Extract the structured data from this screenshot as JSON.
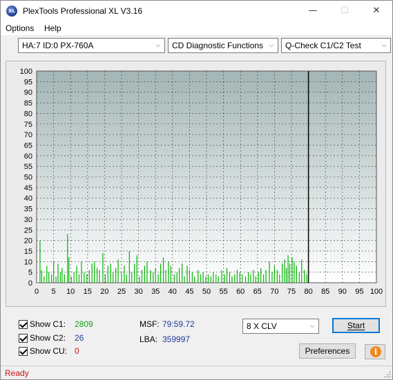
{
  "window": {
    "title": "PlexTools Professional XL V3.16",
    "app_icon_text": "XL",
    "minimize_glyph": "—",
    "maximize_glyph": "☐",
    "close_glyph": "✕"
  },
  "menu": {
    "items": [
      "Options",
      "Help"
    ]
  },
  "toolbar": {
    "drive": "HA:7 ID:0  PX-760A",
    "function": "CD Diagnostic Functions",
    "test": "Q-Check C1/C2 Test",
    "arrow_glyph": "⌵"
  },
  "chart_data": {
    "type": "bar",
    "title": "",
    "xlabel": "",
    "ylabel": "",
    "xlim": [
      0,
      100
    ],
    "ylim": [
      0,
      100
    ],
    "x_ticks": [
      0,
      5,
      10,
      15,
      20,
      25,
      30,
      35,
      40,
      45,
      50,
      55,
      60,
      65,
      70,
      75,
      80,
      85,
      90,
      95,
      100
    ],
    "y_ticks": [
      0,
      5,
      10,
      15,
      20,
      25,
      30,
      35,
      40,
      45,
      50,
      55,
      60,
      65,
      70,
      75,
      80,
      85,
      90,
      95,
      100
    ],
    "grid": true,
    "end_marker_x": 80,
    "colors": {
      "c1": "#00b400",
      "plot_bg_top": "#a3b5b5",
      "plot_bg_bottom": "#ffffff",
      "grid": "#3a3a3a"
    },
    "series": [
      {
        "name": "C1",
        "x": [
          1.0,
          1.5,
          2.2,
          3.0,
          3.6,
          4.4,
          5.0,
          5.7,
          6.3,
          7.0,
          7.5,
          8.2,
          9.1,
          9.5,
          10.2,
          11.0,
          11.8,
          12.5,
          13.2,
          14.0,
          14.8,
          15.5,
          16.3,
          17.0,
          17.8,
          18.5,
          19.5,
          20.2,
          21.0,
          21.8,
          22.5,
          23.3,
          24.0,
          25.0,
          25.8,
          26.5,
          27.3,
          28.0,
          28.8,
          29.5,
          30.3,
          31.0,
          31.8,
          32.5,
          33.5,
          34.3,
          35.0,
          35.8,
          36.5,
          37.3,
          38.0,
          38.8,
          39.5,
          40.5,
          41.3,
          42.0,
          42.8,
          43.5,
          44.3,
          45.0,
          45.8,
          46.5,
          47.5,
          48.3,
          49.0,
          49.8,
          50.5,
          51.3,
          52.0,
          52.8,
          53.5,
          54.5,
          55.3,
          56.0,
          56.8,
          57.5,
          58.3,
          59.0,
          59.8,
          60.5,
          61.5,
          62.3,
          63.0,
          63.8,
          64.5,
          65.3,
          66.0,
          66.8,
          67.5,
          68.5,
          69.3,
          70.0,
          70.8,
          71.5,
          72.3,
          73.0,
          73.5,
          74.0,
          74.5,
          75.2,
          75.8,
          76.5,
          77.3,
          78.0,
          78.8,
          79.5
        ],
        "values": [
          20,
          6,
          3,
          8,
          5,
          4,
          10,
          3,
          9,
          5,
          7,
          4,
          23,
          12,
          3,
          5,
          8,
          4,
          10,
          5,
          4,
          6,
          9,
          10,
          7,
          6,
          14,
          4,
          8,
          9,
          5,
          7,
          11,
          5,
          8,
          4,
          15,
          5,
          9,
          13,
          3,
          6,
          8,
          10,
          6,
          5,
          7,
          4,
          9,
          12,
          6,
          10,
          8,
          4,
          5,
          7,
          9,
          3,
          8,
          6,
          5,
          3,
          6,
          4,
          5,
          3,
          4,
          3,
          5,
          4,
          3,
          6,
          4,
          7,
          5,
          3,
          4,
          6,
          5,
          4,
          3,
          5,
          4,
          6,
          3,
          5,
          7,
          4,
          6,
          10,
          5,
          8,
          6,
          4,
          9,
          11,
          7,
          13,
          9,
          12,
          10,
          8,
          5,
          11,
          6,
          4
        ]
      }
    ]
  },
  "stats": {
    "c1_label": "Show C1:",
    "c1_value": "2809",
    "c2_label": "Show C2:",
    "c2_value": "26",
    "cu_label": "Show CU:",
    "cu_value": "0",
    "msf_label": "MSF:",
    "msf_value": "79:59.72",
    "lba_label": "LBA:",
    "lba_value": "359997"
  },
  "controls": {
    "speed": "8 X CLV",
    "start_label": "Start",
    "preferences_label": "Preferences",
    "info_glyph": "i"
  },
  "status": {
    "text": "Ready"
  }
}
